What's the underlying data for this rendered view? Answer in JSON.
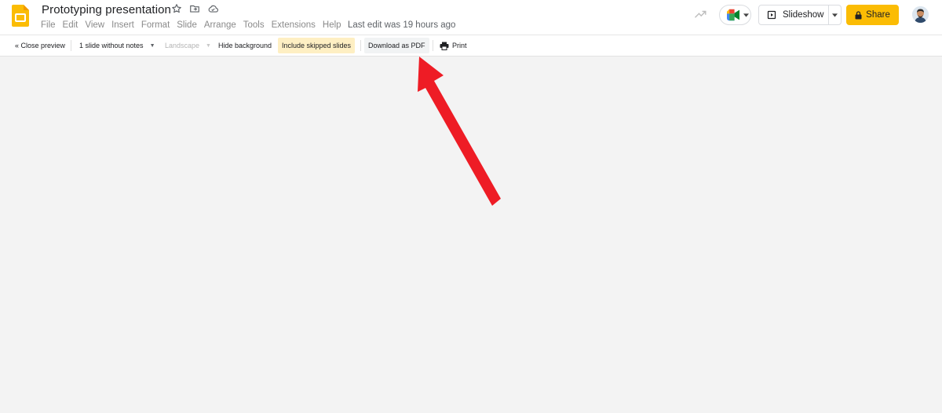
{
  "document": {
    "title": "Prototyping presentation",
    "last_edit": "Last edit was 19 hours ago"
  },
  "menu": [
    "File",
    "Edit",
    "View",
    "Insert",
    "Format",
    "Slide",
    "Arrange",
    "Tools",
    "Extensions",
    "Help"
  ],
  "header_actions": {
    "slideshow_label": "Slideshow",
    "share_label": "Share"
  },
  "toolbar": {
    "close_preview": "« Close preview",
    "layout_select": "1 slide without notes",
    "orientation_select": "Landscape",
    "hide_background": "Hide background",
    "include_skipped": "Include skipped slides",
    "download_pdf": "Download as PDF",
    "print": "Print"
  },
  "colors": {
    "share": "#fbbc04",
    "active_toggle": "#feefc3",
    "annotation_arrow": "#ee1c25"
  },
  "icons": {
    "logo": "slides-logo-icon",
    "star": "star-icon",
    "move": "folder-move-icon",
    "cloud": "cloud-status-icon",
    "trend": "activity-trend-icon",
    "meet": "meet-icon",
    "slideshow": "play-box-icon",
    "lock": "lock-icon",
    "print": "printer-icon"
  }
}
